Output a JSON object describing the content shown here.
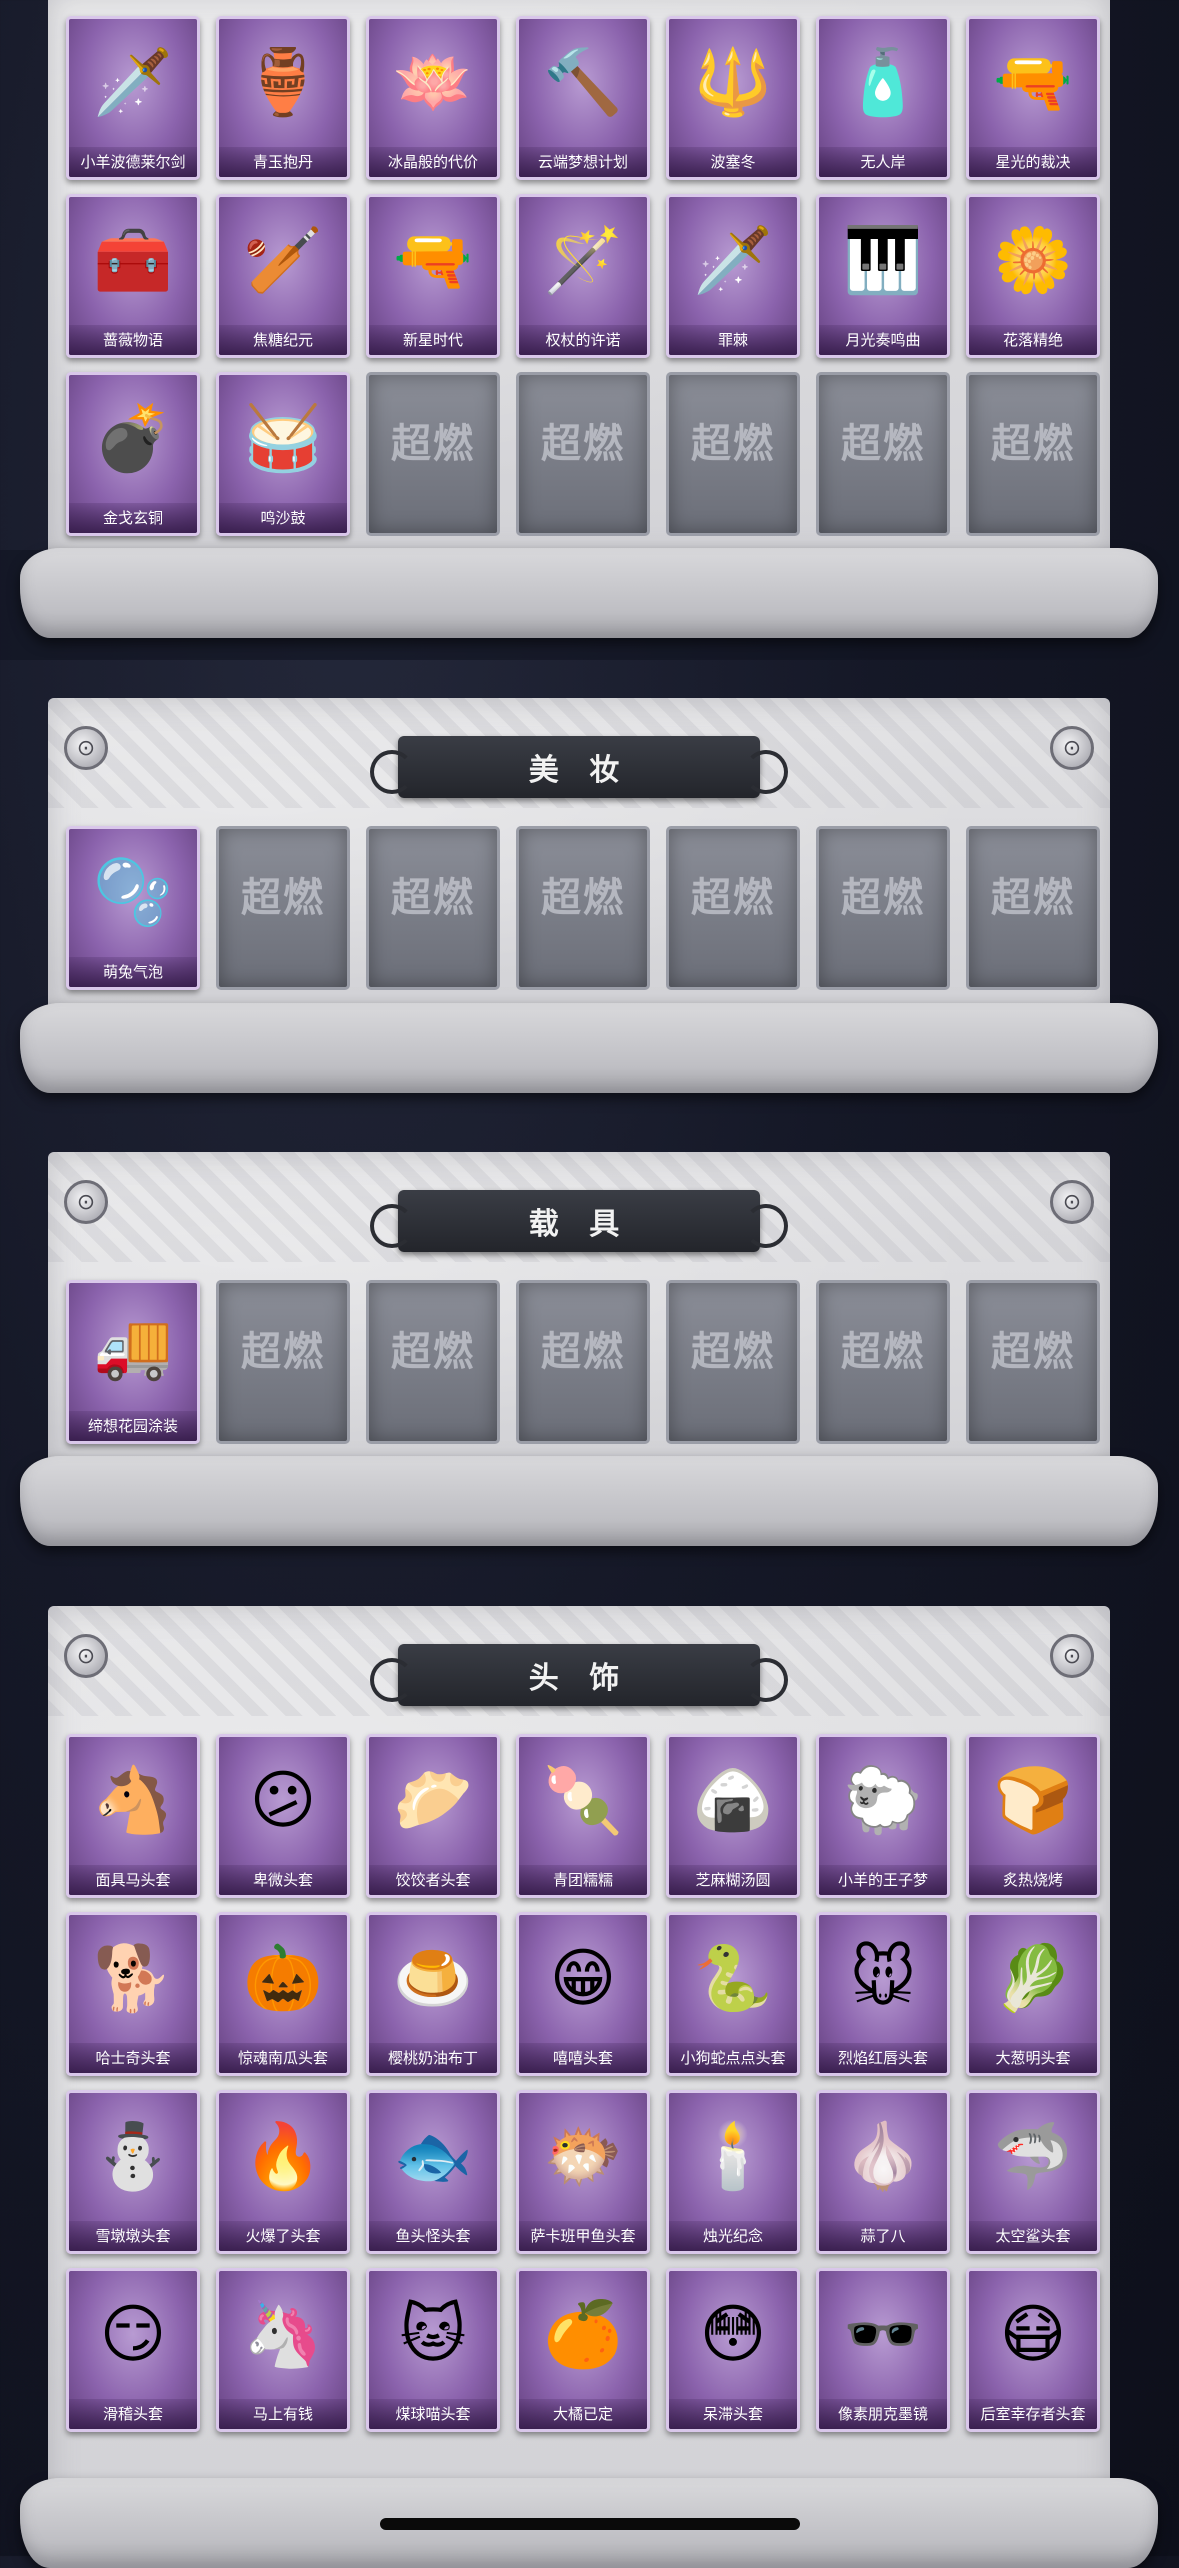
{
  "placeholder": {
    "logo_text": "超燃",
    "logo_sub": ""
  },
  "weapons": {
    "items": [
      {
        "label": "小羊波德莱尔剑",
        "icon": "sword",
        "owned": true
      },
      {
        "label": "青玉抱丹",
        "icon": "jade-vase",
        "owned": true
      },
      {
        "label": "冰晶般的代价",
        "icon": "ice-lotus",
        "owned": true
      },
      {
        "label": "云端梦想计划",
        "icon": "mace",
        "owned": true
      },
      {
        "label": "波塞冬",
        "icon": "trident",
        "owned": true
      },
      {
        "label": "无人岸",
        "icon": "perfume-bottle",
        "owned": true
      },
      {
        "label": "星光的裁决",
        "icon": "shotgun",
        "owned": true
      },
      {
        "label": "蔷薇物语",
        "icon": "first-aid-case",
        "owned": true
      },
      {
        "label": "焦糖纪元",
        "icon": "club",
        "owned": true
      },
      {
        "label": "新星时代",
        "icon": "revolver",
        "owned": true
      },
      {
        "label": "权杖的许诺",
        "icon": "scepter",
        "owned": true
      },
      {
        "label": "罪棘",
        "icon": "spear",
        "owned": true
      },
      {
        "label": "月光奏鸣曲",
        "icon": "piano",
        "owned": true
      },
      {
        "label": "花落精绝",
        "icon": "flower-pendant",
        "owned": true
      },
      {
        "label": "金戈玄铜",
        "icon": "grenade",
        "owned": true
      },
      {
        "label": "鸣沙鼓",
        "icon": "drum",
        "owned": true
      },
      {
        "label": "",
        "owned": false
      },
      {
        "label": "",
        "owned": false
      },
      {
        "label": "",
        "owned": false
      },
      {
        "label": "",
        "owned": false
      },
      {
        "label": "",
        "owned": false
      }
    ]
  },
  "makeup": {
    "title": "美 妆",
    "items": [
      {
        "label": "萌兔气泡",
        "icon": "bubble-head",
        "owned": true
      },
      {
        "label": "",
        "owned": false
      },
      {
        "label": "",
        "owned": false
      },
      {
        "label": "",
        "owned": false
      },
      {
        "label": "",
        "owned": false
      },
      {
        "label": "",
        "owned": false
      },
      {
        "label": "",
        "owned": false
      }
    ]
  },
  "vehicles": {
    "title": "载 具",
    "items": [
      {
        "label": "缔想花园涂装",
        "icon": "truck",
        "owned": true
      },
      {
        "label": "",
        "owned": false
      },
      {
        "label": "",
        "owned": false
      },
      {
        "label": "",
        "owned": false
      },
      {
        "label": "",
        "owned": false
      },
      {
        "label": "",
        "owned": false
      },
      {
        "label": "",
        "owned": false
      }
    ]
  },
  "headwear": {
    "title": "头 饰",
    "items": [
      {
        "label": "面具马头套",
        "icon": "horse-head",
        "owned": true
      },
      {
        "label": "卑微头套",
        "icon": "sad-face",
        "owned": true
      },
      {
        "label": "饺饺者头套",
        "icon": "dumpling",
        "owned": true
      },
      {
        "label": "青团糯糯",
        "icon": "green-dumpling",
        "owned": true
      },
      {
        "label": "芝麻糊汤圆",
        "icon": "rice-ball",
        "owned": true
      },
      {
        "label": "小羊的王子梦",
        "icon": "sheep-crown",
        "owned": true
      },
      {
        "label": "炙热烧烤",
        "icon": "toast",
        "owned": true
      },
      {
        "label": "哈士奇头套",
        "icon": "husky",
        "owned": true
      },
      {
        "label": "惊魂南瓜头套",
        "icon": "pumpkin",
        "owned": true
      },
      {
        "label": "樱桃奶油布丁",
        "icon": "pudding",
        "owned": true
      },
      {
        "label": "嘻嘻头套",
        "icon": "grin-face",
        "owned": true
      },
      {
        "label": "小狗蛇点点头套",
        "icon": "snake",
        "owned": true
      },
      {
        "label": "烈焰红唇头套",
        "icon": "pikachu",
        "owned": true
      },
      {
        "label": "大葱明头套",
        "icon": "scallion",
        "owned": true
      },
      {
        "label": "雪墩墩头套",
        "icon": "snowman",
        "owned": true
      },
      {
        "label": "火爆了头套",
        "icon": "fire",
        "owned": true
      },
      {
        "label": "鱼头怪头套",
        "icon": "fish-head",
        "owned": true
      },
      {
        "label": "萨卡班甲鱼头套",
        "icon": "round-fish",
        "owned": true
      },
      {
        "label": "烛光纪念",
        "icon": "candle",
        "owned": true
      },
      {
        "label": "蒜了八",
        "icon": "garlic",
        "owned": true
      },
      {
        "label": "太空鲨头套",
        "icon": "shark",
        "owned": true
      },
      {
        "label": "滑稽头套",
        "icon": "funny-face",
        "owned": true
      },
      {
        "label": "马上有钱",
        "icon": "pink-horse",
        "owned": true
      },
      {
        "label": "煤球喵头套",
        "icon": "cat",
        "owned": true
      },
      {
        "label": "大橘已定",
        "icon": "orange",
        "owned": true
      },
      {
        "label": "呆滞头套",
        "icon": "dazed-face",
        "owned": true
      },
      {
        "label": "像素朋克墨镜",
        "icon": "pixel-sunglasses",
        "owned": true
      },
      {
        "label": "后室幸存者头套",
        "icon": "gas-mask",
        "owned": true
      }
    ]
  }
}
